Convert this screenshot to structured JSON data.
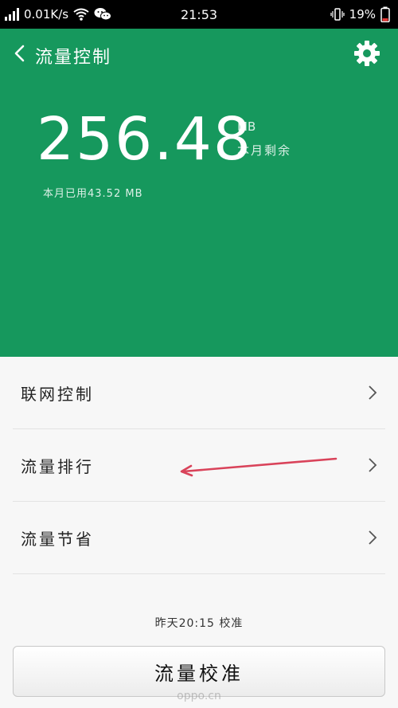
{
  "status_bar": {
    "network_speed": "0.01K/s",
    "time": "21:53",
    "battery": "19%"
  },
  "header": {
    "title": "流量控制",
    "remaining_value": "256.48",
    "remaining_unit": "MB",
    "remaining_label": "本月剩余",
    "used_label": "本月已用43.52 MB"
  },
  "menu": {
    "items": [
      {
        "label": "联网控制"
      },
      {
        "label": "流量排行"
      },
      {
        "label": "流量节省"
      }
    ]
  },
  "calibration": {
    "note": "昨天20:15 校准",
    "button_label": "流量校准"
  },
  "watermark": "oppo.cn",
  "colors": {
    "header_bg": "#16985d",
    "arrow": "#d9435a"
  }
}
